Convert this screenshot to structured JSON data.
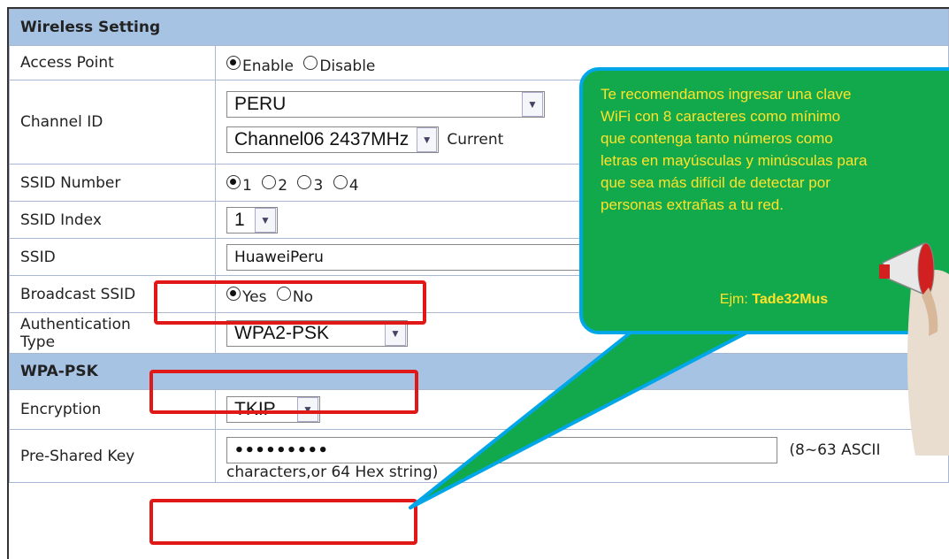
{
  "section_wireless": "Wireless Setting",
  "rows": {
    "access_point": {
      "label": "Access Point",
      "opt_enable": "Enable",
      "opt_disable": "Disable"
    },
    "channel_id": {
      "label": "Channel ID",
      "country": "PERU",
      "channel": "Channel06 2437MHz",
      "current": "Current"
    },
    "ssid_number": {
      "label": "SSID Number",
      "opts": [
        "1",
        "2",
        "3",
        "4"
      ]
    },
    "ssid_index": {
      "label": "SSID Index",
      "value": "1"
    },
    "ssid": {
      "label": "SSID",
      "value": "HuaweiPeru"
    },
    "broadcast": {
      "label": "Broadcast SSID",
      "opt_yes": "Yes",
      "opt_no": "No"
    },
    "auth": {
      "label_line1": "Authentication",
      "label_line2": "Type",
      "value": "WPA2-PSK"
    }
  },
  "section_wpa": "WPA-PSK",
  "wpa": {
    "encryption": {
      "label": "Encryption",
      "value": "TKIP"
    },
    "psk": {
      "label": "Pre-Shared Key",
      "value": "•••••••••",
      "hint": "(8~63 ASCII",
      "hint2": "characters,or 64 Hex string)"
    }
  },
  "callout": {
    "lines": [
      "Te recomendamos ingresar una clave",
      "WiFi con 8 caracteres como mínimo",
      "que contenga tanto números como",
      "letras en mayúsculas y minúsculas para",
      "que sea más difícil de detectar por",
      "personas extrañas a tu red."
    ],
    "example_prefix": "Ejm: ",
    "example_value": "Tade32Mus"
  },
  "colors": {
    "section_bg": "#a7c3e4",
    "highlight": "#e01818",
    "bubble_bg": "#12a94c",
    "bubble_border": "#00a6e8",
    "bubble_text": "#ffe22a"
  }
}
